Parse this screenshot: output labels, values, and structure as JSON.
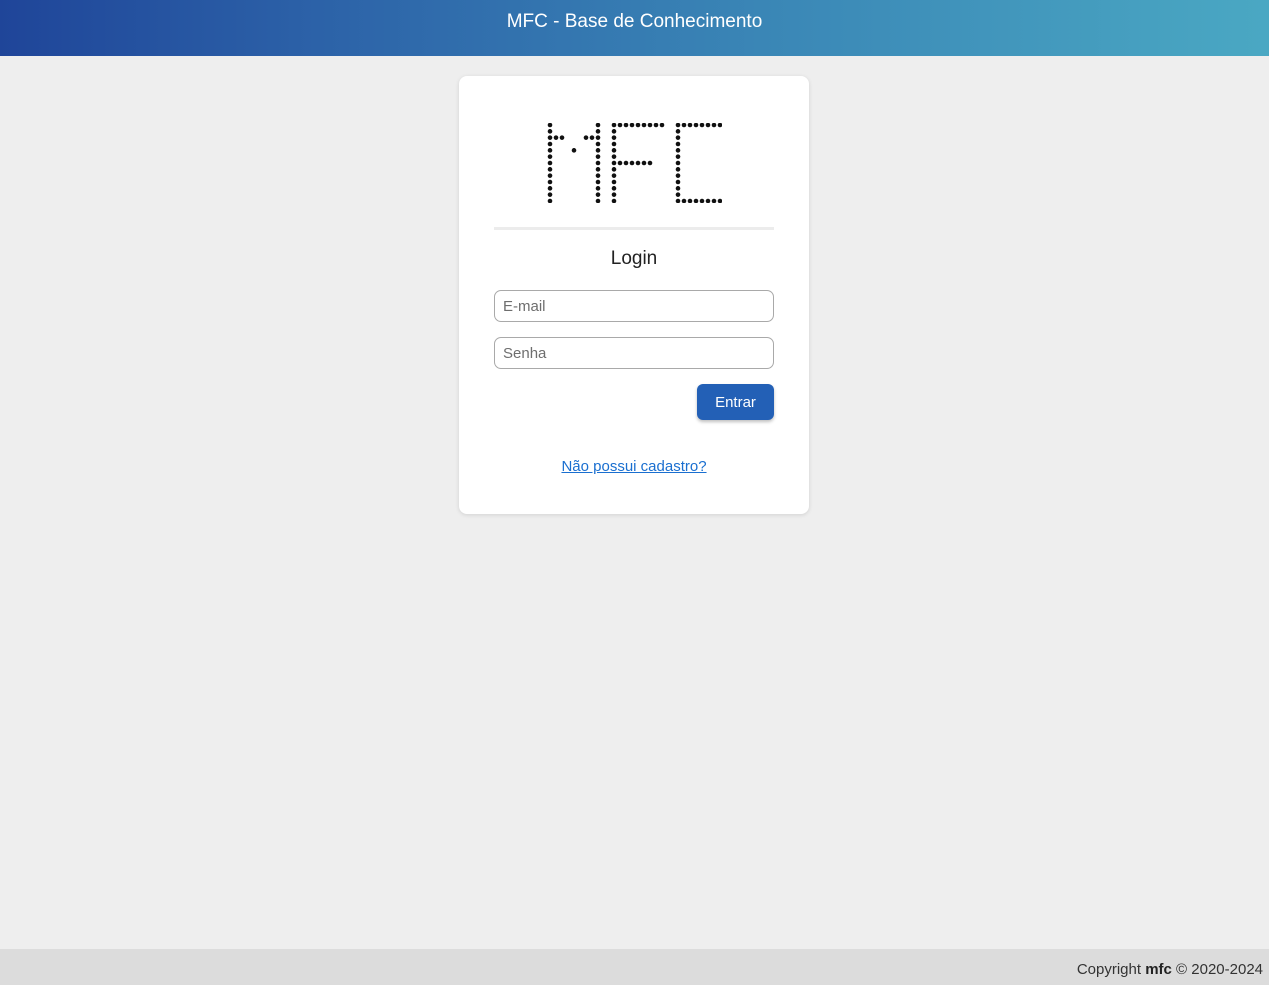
{
  "header": {
    "title": "MFC - Base de Conhecimento"
  },
  "login_card": {
    "logo_text": "MFC",
    "heading": "Login",
    "email_placeholder": "E-mail",
    "email_value": "",
    "password_placeholder": "Senha",
    "password_value": "",
    "submit_label": "Entrar",
    "signup_link": "Não possui cadastro?"
  },
  "footer": {
    "copyright_prefix": "Copyright",
    "brand": "mfc",
    "years": "© 2020-2024"
  },
  "colors": {
    "header_start": "#1f4599",
    "header_end": "#4aa8c3",
    "button": "#2360b6",
    "link": "#1a6fd0",
    "page_bg": "#eeeeee",
    "footer_bg": "#dcdcdc"
  }
}
